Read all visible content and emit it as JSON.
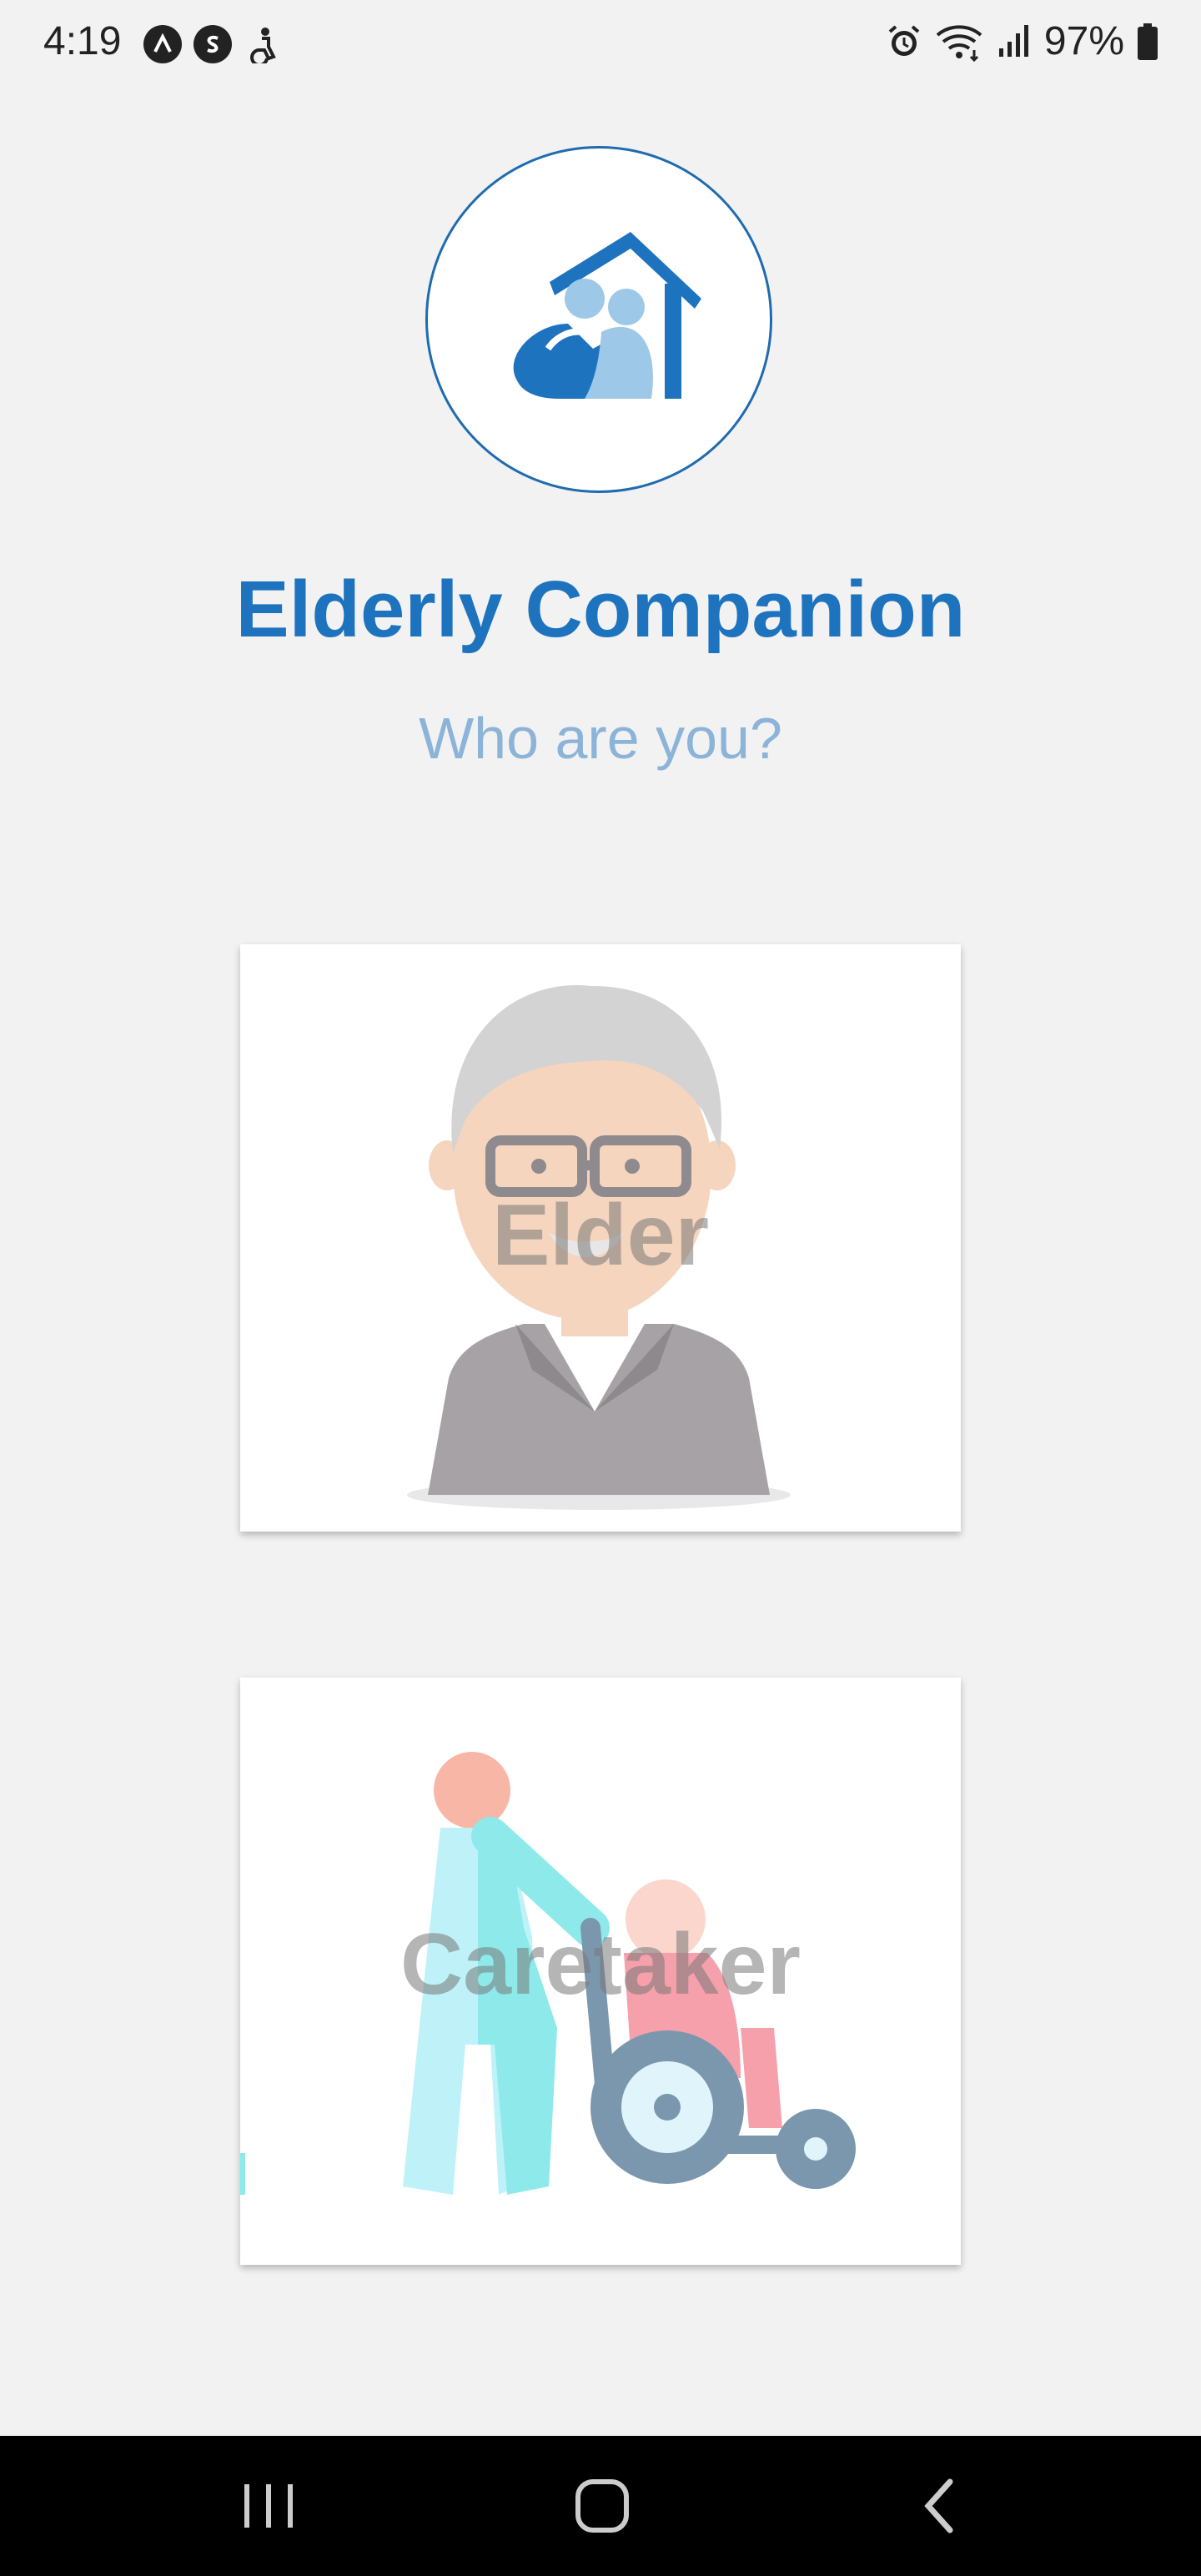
{
  "status_bar": {
    "time": "4:19",
    "battery": "97%",
    "left_icons": [
      "app-a-icon",
      "app-s-icon",
      "accessibility-icon"
    ],
    "right_icons": [
      "alarm-icon",
      "wifi-icon",
      "signal-icon",
      "battery-icon"
    ]
  },
  "app": {
    "title": "Elderly Companion",
    "subtitle": "Who are you?",
    "logo_icon": "house-hug-icon",
    "accent_color": "#1e73be"
  },
  "roles": [
    {
      "label": "Elder",
      "illustration": "elderly-man-icon"
    },
    {
      "label": "Caretaker",
      "illustration": "caretaker-wheelchair-icon"
    }
  ],
  "nav_bar": {
    "buttons": [
      "recents-icon",
      "home-icon",
      "back-icon"
    ]
  }
}
